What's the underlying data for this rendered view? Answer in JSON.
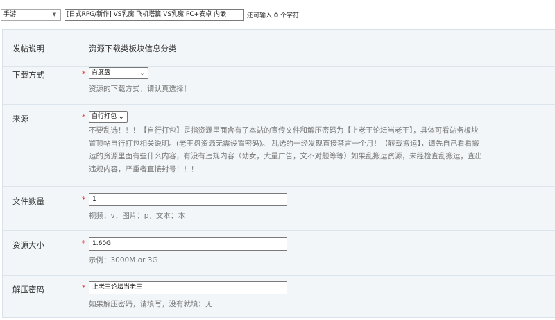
{
  "topbar": {
    "category_value": "手游",
    "title_value": "[日式RPG/新作] VS乳魔 飞机塔篇 VS乳魔 PC+安卓 内嵌",
    "char_hint_prefix": "还可输入",
    "char_hint_count": "0",
    "char_hint_suffix": "个字符"
  },
  "form": {
    "post_desc": {
      "label": "发帖说明",
      "value": "资源下载类板块信息分类"
    },
    "download": {
      "label": "下载方式",
      "selected": "百度盘",
      "help": "资源的下载方式，请认真选择！"
    },
    "source": {
      "label": "来源",
      "selected": "自行打包",
      "help_lines": [
        "不要乱选！！！【自行打包】是指资源里面含有了本站的宣传文件和解压密码为【上老王论坛当老王】，具体可看站务板块",
        "置顶帖自行打包相关说明。(老王盘资源无需设置密码)。 乱选的一经发现直接禁言一个月！【转载搬运】，请先自己看看搬",
        "运的资源里面有些什么内容，有没有违规内容（幼女，大量广告，文不对题等等）如果乱搬运资源，未经检查乱搬运，查出",
        "违规内容，严重者直接封号！！！"
      ]
    },
    "file_count": {
      "label": "文件数量",
      "value": "1",
      "help": "视频：v，图片：p，文本：本"
    },
    "size": {
      "label": "资源大小",
      "value": "1.60G",
      "help": "示例：3000M or 3G"
    },
    "password": {
      "label": "解压密码",
      "value": "上老王论坛当老王",
      "help": "如果解压密码，请填写，没有就填：无"
    }
  }
}
